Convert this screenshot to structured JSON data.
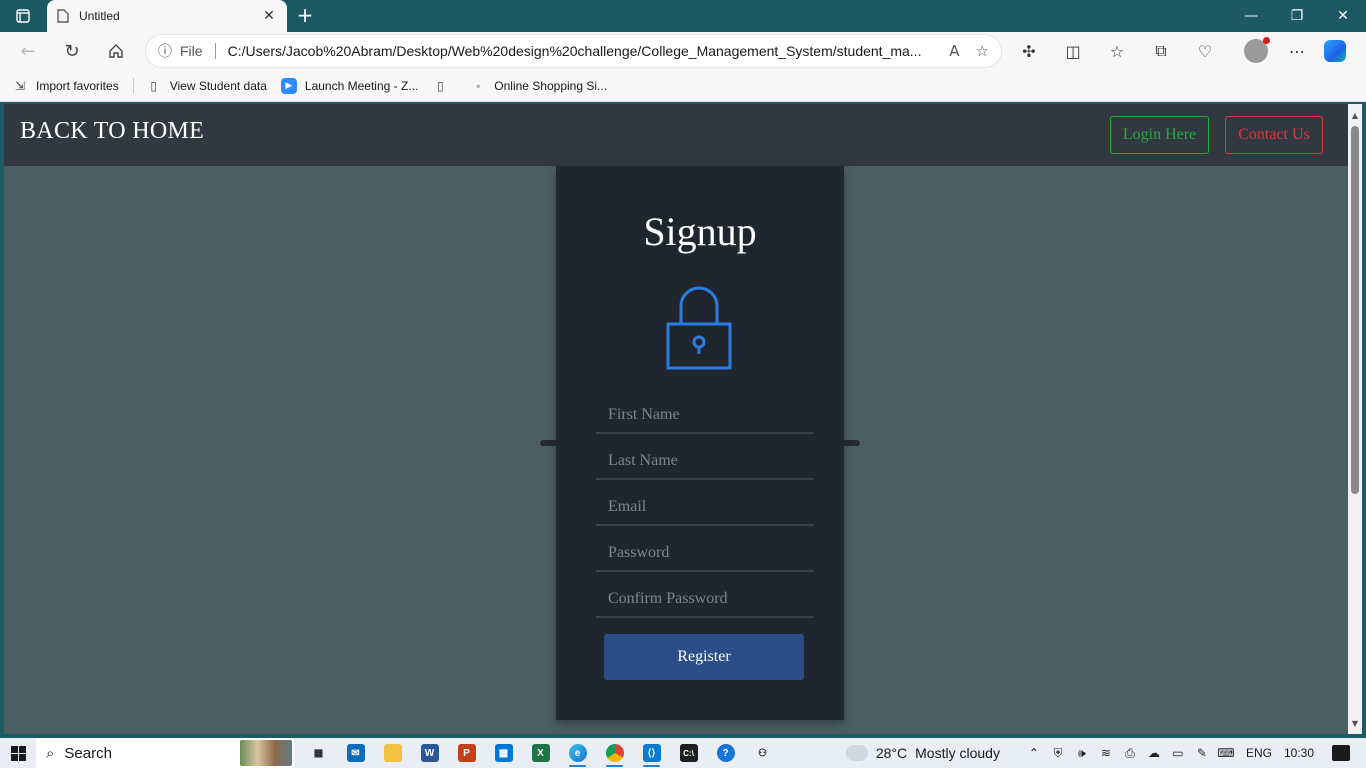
{
  "browser": {
    "tab_title": "Untitled",
    "address_protocol": "File",
    "address_url": "C:/Users/Jacob%20Abram/Desktop/Web%20design%20challenge/College_Management_System/student_ma...",
    "favorites": [
      {
        "label": "Import favorites",
        "icon": "import-favorites-icon"
      },
      {
        "label": "View Student data",
        "icon": "page-icon"
      },
      {
        "label": "Launch Meeting - Z...",
        "icon": "zoom-icon"
      },
      {
        "label": "",
        "icon": "page-icon"
      },
      {
        "label": "Online Shopping Si...",
        "icon": "site-icon"
      }
    ]
  },
  "header": {
    "home_link": "BACK TO HOME",
    "login_button": "Login Here",
    "contact_button": "Contact Us"
  },
  "signup": {
    "title": "Signup",
    "fields": {
      "first_name": "First Name",
      "last_name": "Last Name",
      "email": "Email",
      "password": "Password",
      "confirm_password": "Confirm Password"
    },
    "register_button": "Register"
  },
  "colors": {
    "page_bg": "#4a5e63",
    "header_bg": "#32383f",
    "card_bg": "#1f262f",
    "lock_stroke": "#2a7de1",
    "login_green": "#28a745",
    "contact_red": "#dc3545",
    "register_bg": "#2b4e86"
  },
  "taskbar": {
    "search_label": "Search",
    "weather_temp": "28°C",
    "weather_text": "Mostly cloudy",
    "language": "ENG",
    "time": "10:30"
  }
}
